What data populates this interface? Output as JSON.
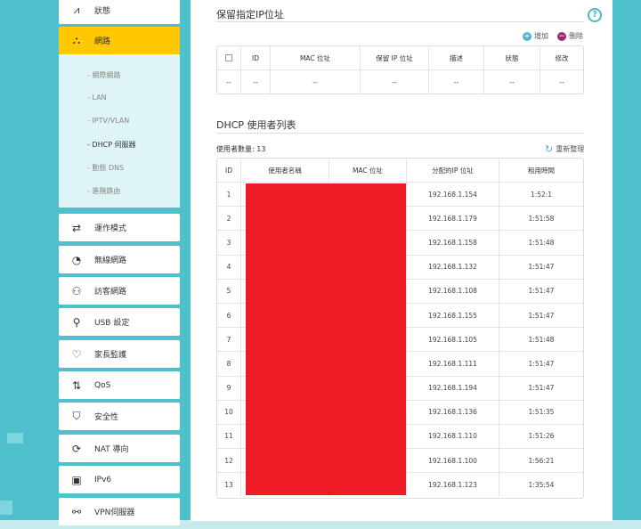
{
  "sidebar": {
    "items": [
      {
        "label": "狀態",
        "icon": "status-icon",
        "glyph": "⩘"
      },
      {
        "label": "網路",
        "icon": "network-icon",
        "glyph": "⛬",
        "active": true
      },
      {
        "label": "運作模式",
        "icon": "mode-icon",
        "glyph": "⇄"
      },
      {
        "label": "無線網路",
        "icon": "wireless-icon",
        "glyph": "◔"
      },
      {
        "label": "訪客網路",
        "icon": "guest-icon",
        "glyph": "⚇"
      },
      {
        "label": "USB 設定",
        "icon": "usb-icon",
        "glyph": "⚲"
      },
      {
        "label": "家長監護",
        "icon": "parental-icon",
        "glyph": "♡"
      },
      {
        "label": "QoS",
        "icon": "qos-icon",
        "glyph": "⇅"
      },
      {
        "label": "安全性",
        "icon": "shield-icon",
        "glyph": "⛉"
      },
      {
        "label": "NAT 導向",
        "icon": "nat-icon",
        "glyph": "⟳"
      },
      {
        "label": "IPv6",
        "icon": "ipv6-icon",
        "glyph": "▣"
      },
      {
        "label": "VPN伺服器",
        "icon": "vpn-icon",
        "glyph": "⚯"
      }
    ],
    "submenu": [
      {
        "label": "- 網際網路"
      },
      {
        "label": "- LAN"
      },
      {
        "label": "- IPTV/VLAN"
      },
      {
        "label": "- DHCP 伺服器",
        "active": true
      },
      {
        "label": "- 動態 DNS"
      },
      {
        "label": "- 進階路由"
      }
    ]
  },
  "reserved": {
    "title": "保留指定IP位址",
    "add_label": "增加",
    "delete_label": "刪除",
    "headers": [
      "",
      "ID",
      "MAC 位址",
      "保留 IP 位址",
      "描述",
      "狀態",
      "修改"
    ],
    "empty_row": [
      "--",
      "--",
      "--",
      "--",
      "--",
      "--",
      "--"
    ]
  },
  "dhcp": {
    "title": "DHCP 使用者列表",
    "count_label": "使用者數量: 13",
    "refresh_label": "重新整理",
    "headers": [
      "ID",
      "使用者名稱",
      "MAC 位址",
      "分配的IP 位址",
      "租用時間"
    ],
    "rows": [
      {
        "id": "1",
        "name": "",
        "mac": "",
        "ip": "192.168.1.154",
        "lease": "1:52:1"
      },
      {
        "id": "2",
        "name": "",
        "mac": "",
        "ip": "192.168.1.179",
        "lease": "1:51:58"
      },
      {
        "id": "3",
        "name": "",
        "mac": "",
        "ip": "192.168.1.158",
        "lease": "1:51:48"
      },
      {
        "id": "4",
        "name": "",
        "mac": "",
        "ip": "192.168.1.132",
        "lease": "1:51:47"
      },
      {
        "id": "5",
        "name": "",
        "mac": "",
        "ip": "192.168.1.108",
        "lease": "1:51:47"
      },
      {
        "id": "6",
        "name": "",
        "mac": "",
        "ip": "192.168.1.155",
        "lease": "1:51:47"
      },
      {
        "id": "7",
        "name": "",
        "mac": "",
        "ip": "192.168.1.105",
        "lease": "1:51:48"
      },
      {
        "id": "8",
        "name": "",
        "mac": "",
        "ip": "192.168.1.111",
        "lease": "1:51:47"
      },
      {
        "id": "9",
        "name": "",
        "mac": "",
        "ip": "192.168.1.194",
        "lease": "1:51:47"
      },
      {
        "id": "10",
        "name": "",
        "mac": "",
        "ip": "192.168.1.136",
        "lease": "1:51:35"
      },
      {
        "id": "11",
        "name": "",
        "mac": "",
        "ip": "192.168.1.110",
        "lease": "1:51:26"
      },
      {
        "id": "12",
        "name": "",
        "mac": "",
        "ip": "192.168.1.100",
        "lease": "1:56:21"
      },
      {
        "id": "13",
        "name": "",
        "mac": "",
        "ip": "192.168.1.123",
        "lease": "1:35:54"
      }
    ]
  },
  "colors": {
    "accent": "#4eb6c8",
    "active_nav": "#ffc800",
    "redaction": "#ed1c24",
    "add": "#4eb6c8",
    "delete": "#9c2b6c"
  }
}
